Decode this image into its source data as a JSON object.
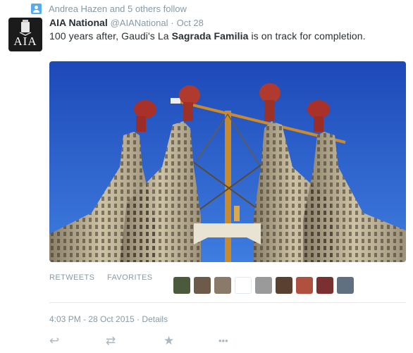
{
  "context": {
    "text": "Andrea Hazen and 5 others follow",
    "icon": "follow-icon"
  },
  "tweet": {
    "avatar_text": "AIA",
    "name": "AIA National",
    "handle": "@AIANational",
    "separator": "·",
    "date": "Oct 28",
    "text_pre": "100 years after, Gaudi's La ",
    "text_bold": "Sagrada Familia",
    "text_post": " is on track for completion."
  },
  "stats": {
    "retweets_label": "RETWEETS",
    "favorites_label": "FAVORITES",
    "favoriters": [
      {
        "name": "avatar-1",
        "color": "#4a5a3a"
      },
      {
        "name": "avatar-2",
        "color": "#6d5a48"
      },
      {
        "name": "avatar-3",
        "color": "#8a7a6a"
      },
      {
        "name": "avatar-4",
        "color": "#ffffff"
      },
      {
        "name": "avatar-5",
        "color": "#9a9a9a"
      },
      {
        "name": "avatar-6",
        "color": "#5a4030"
      },
      {
        "name": "avatar-7",
        "color": "#b05040"
      },
      {
        "name": "avatar-8",
        "color": "#7a3030"
      },
      {
        "name": "avatar-9",
        "color": "#607080"
      }
    ]
  },
  "meta": {
    "time": "4:03 PM - 28 Oct 2015",
    "separator": "·",
    "details": "Details"
  },
  "actions": [
    {
      "name": "reply-icon",
      "glyph": "↩"
    },
    {
      "name": "retweet-icon",
      "glyph": "⇄"
    },
    {
      "name": "favorite-icon",
      "glyph": "★"
    },
    {
      "name": "more-icon",
      "glyph": "•••"
    }
  ],
  "colors": {
    "accent": "#55acee",
    "muted": "#8899a6",
    "text": "#292f33"
  }
}
